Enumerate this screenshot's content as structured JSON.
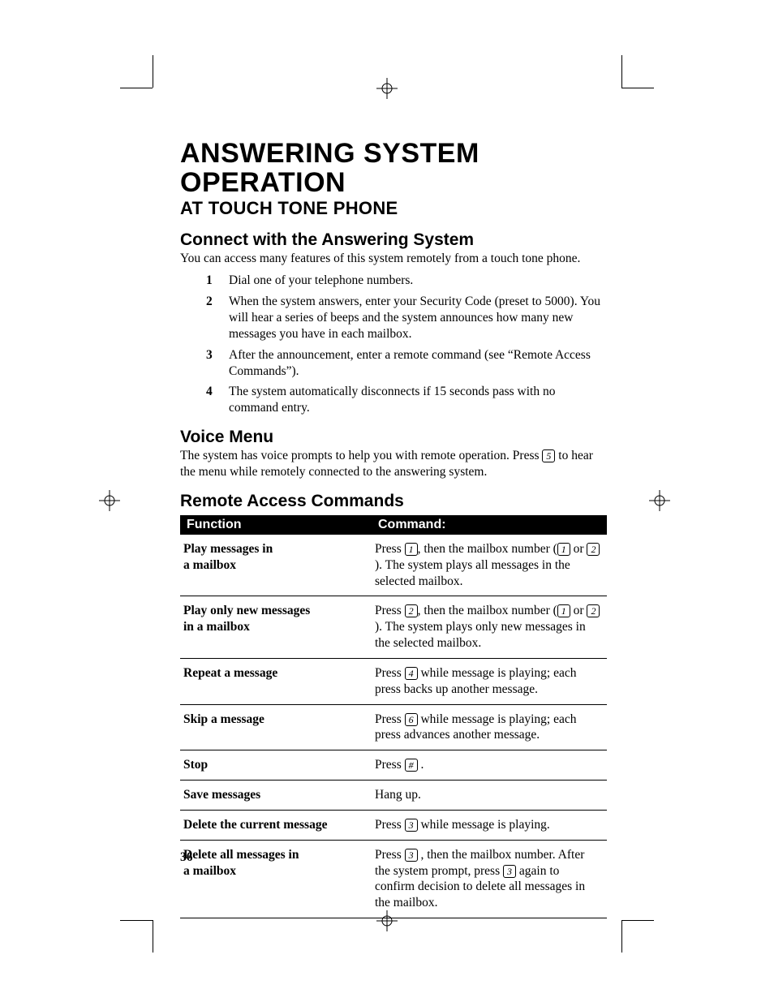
{
  "title": "ANSWERING SYSTEM OPERATION",
  "subtitle": "AT TOUCH TONE PHONE",
  "section1": {
    "head": "Connect with the Answering System",
    "intro": "You can access many features of this system remotely from a touch tone phone.",
    "steps": [
      "Dial one of your telephone numbers.",
      "When the system answers, enter your Security Code (preset to 5000). You will hear a series of beeps and the system announces how many new messages you have in each mailbox.",
      "After the announcement, enter a remote command (see “Remote Access Commands”).",
      "The system automatically disconnects if 15 seconds pass with no command entry."
    ]
  },
  "section2": {
    "head": "Voice Menu",
    "body_pre": "The system has voice prompts to help you with remote operation.  Press ",
    "key": "5",
    "body_post": " to hear the menu while remotely connected to the answering system."
  },
  "section3": {
    "head": "Remote Access Commands",
    "cols": {
      "fn": "Function",
      "cmd": "Command:"
    },
    "rows": [
      {
        "fn_lines": [
          "Play messages in",
          "a mailbox"
        ],
        "cmd_parts": [
          {
            "t": "Press "
          },
          {
            "k": "1"
          },
          {
            "t": ", then the mailbox number ("
          },
          {
            "k": "1"
          },
          {
            "t": " or "
          },
          {
            "k": "2"
          },
          {
            "t": "). The system plays all messages in the selected mailbox."
          }
        ]
      },
      {
        "fn_lines": [
          "Play only new messages",
          "in a mailbox"
        ],
        "cmd_parts": [
          {
            "t": "Press "
          },
          {
            "k": "2"
          },
          {
            "t": ", then the mailbox number ("
          },
          {
            "k": "1"
          },
          {
            "t": " or "
          },
          {
            "k": "2"
          },
          {
            "t": "). The system plays only new messages in the selected mailbox."
          }
        ]
      },
      {
        "fn_lines": [
          "Repeat a message"
        ],
        "cmd_parts": [
          {
            "t": "Press "
          },
          {
            "k": "4"
          },
          {
            "t": " while message is playing; each press backs up another message."
          }
        ]
      },
      {
        "fn_lines": [
          "Skip a message"
        ],
        "cmd_parts": [
          {
            "t": "Press "
          },
          {
            "k": "6"
          },
          {
            "t": " while message is playing; each press advances another message."
          }
        ]
      },
      {
        "fn_lines": [
          "Stop"
        ],
        "cmd_parts": [
          {
            "t": "Press "
          },
          {
            "k": "#"
          },
          {
            "t": " ."
          }
        ]
      },
      {
        "fn_lines": [
          "Save messages"
        ],
        "cmd_parts": [
          {
            "t": "Hang up."
          }
        ]
      },
      {
        "fn_lines": [
          "Delete the current message"
        ],
        "cmd_parts": [
          {
            "t": "Press "
          },
          {
            "k": "3"
          },
          {
            "t": " while message is playing."
          }
        ]
      },
      {
        "fn_lines": [
          "Delete all messages in",
          "a mailbox"
        ],
        "cmd_parts": [
          {
            "t": "Press "
          },
          {
            "k": "3"
          },
          {
            "t": " , then the mailbox number. After the system prompt, press "
          },
          {
            "k": "3"
          },
          {
            "t": " again to confirm decision to delete all messages in the mailbox."
          }
        ]
      }
    ]
  },
  "page_number": "36"
}
